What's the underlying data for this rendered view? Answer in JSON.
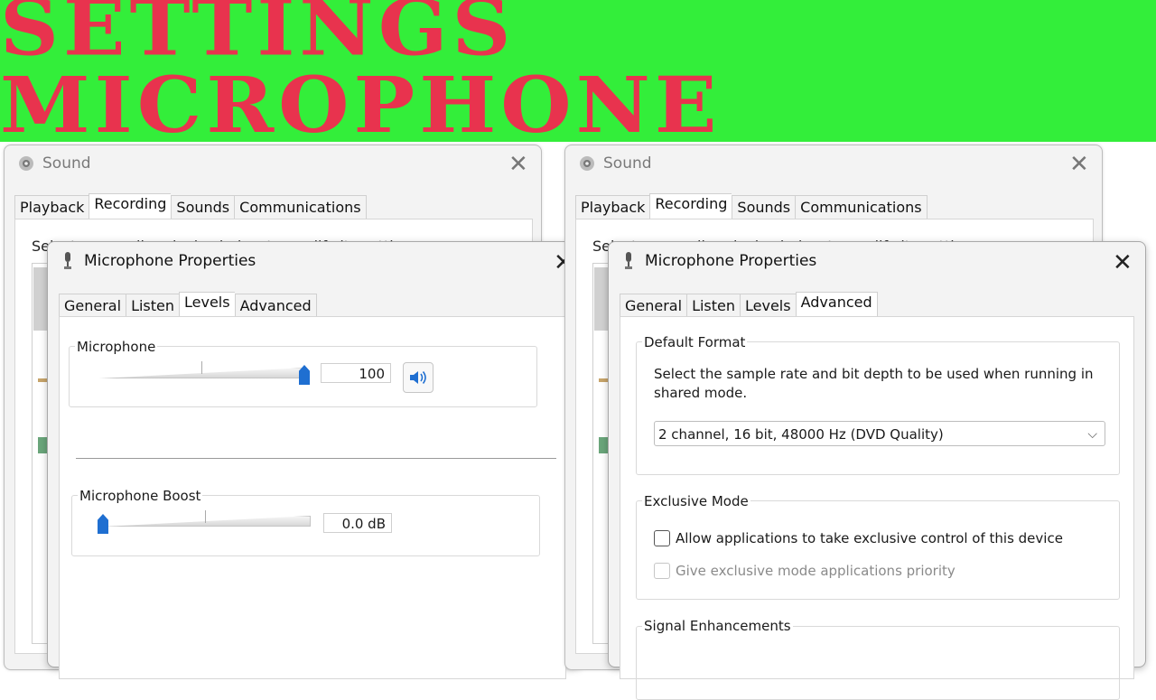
{
  "banner": {
    "title": "SETTINGS MICROPHONE"
  },
  "colors": {
    "banner_bg": "#33ee3a",
    "banner_text": "#e8334e",
    "accent": "#1f6fd1"
  },
  "sound_dialog": {
    "title": "Sound",
    "close_icon": "close-icon",
    "tabs": [
      "Playback",
      "Recording",
      "Sounds",
      "Communications"
    ],
    "active_tab": "Recording",
    "peek_text": "Select a recording device below to modify its settings:"
  },
  "mic_left": {
    "title": "Microphone Properties",
    "tabs": [
      "General",
      "Listen",
      "Levels",
      "Advanced"
    ],
    "active_tab": "Levels",
    "microphone": {
      "label": "Microphone",
      "level_percent": 100,
      "value": "100",
      "speaker_icon": "speaker-icon"
    },
    "boost": {
      "label": "Microphone Boost",
      "level_percent": 0,
      "value": "0.0 dB"
    }
  },
  "mic_right": {
    "title": "Microphone Properties",
    "tabs": [
      "General",
      "Listen",
      "Levels",
      "Advanced"
    ],
    "active_tab": "Advanced",
    "default_format": {
      "label": "Default Format",
      "description": "Select the sample rate and bit depth to be used when running in shared mode.",
      "selected": "2 channel, 16 bit, 48000 Hz (DVD Quality)"
    },
    "exclusive_mode": {
      "label": "Exclusive Mode",
      "allow_label": "Allow applications to take exclusive control of this device",
      "allow_checked": false,
      "priority_label": "Give exclusive mode applications priority",
      "priority_checked": false,
      "priority_enabled": false
    },
    "signal_enhancements": {
      "label": "Signal Enhancements"
    }
  }
}
